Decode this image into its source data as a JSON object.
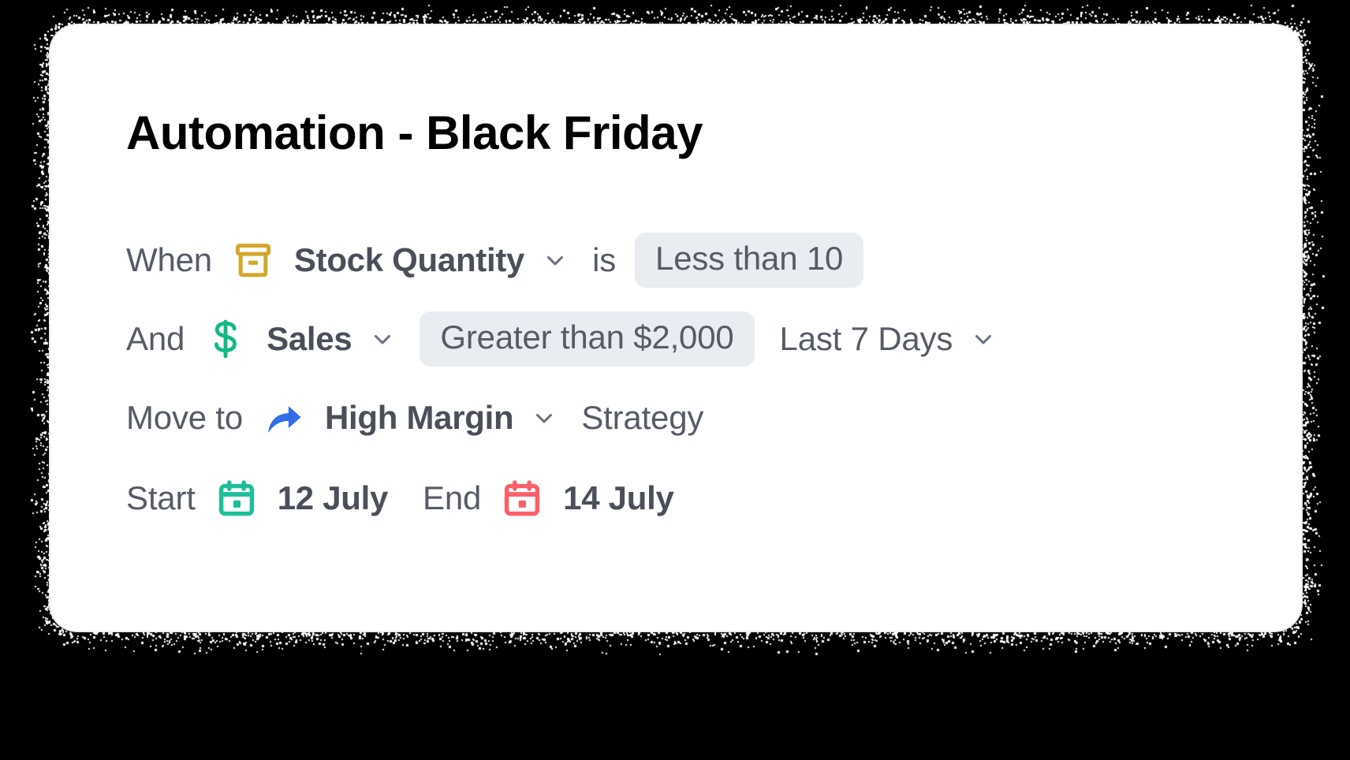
{
  "window": {
    "background_color": "#000000",
    "card_background": "#ffffff"
  },
  "card": {
    "title": "Automation - Black Friday"
  },
  "colors": {
    "text_plain": "#565b66",
    "text_bold": "#4a4f5a",
    "pill_background": "#e9ecf1",
    "stock_icon": "#d4a72c",
    "sales_icon": "#12b886",
    "move_icon": "#2f6ee6",
    "start_calendar_icon": "#1dbf9a",
    "end_calendar_icon": "#fb5f68"
  },
  "rules": [
    {
      "id": "when-stock-quantity",
      "prefix": "When",
      "icon": "inventory-box-icon",
      "field": "Stock Quantity",
      "has_field_dropdown": true,
      "operator_label": "is",
      "pill": "Less than 10",
      "suffix": null,
      "suffix_dropdown": false
    },
    {
      "id": "and-sales",
      "prefix": "And",
      "icon": "dollar-icon",
      "field": "Sales",
      "has_field_dropdown": true,
      "operator_label": null,
      "pill": "Greater than $2,000",
      "suffix": "Last 7 Days",
      "suffix_dropdown": true
    },
    {
      "id": "move-to-high-margin",
      "prefix": "Move to",
      "icon": "curved-arrow-icon",
      "field": "High Margin",
      "has_field_dropdown": true,
      "operator_label": null,
      "pill": null,
      "suffix": "Strategy",
      "suffix_dropdown": false
    }
  ],
  "schedule": {
    "start_label": "Start",
    "start_icon": "calendar-start-icon",
    "start_value": "12 July",
    "end_label": "End",
    "end_icon": "calendar-end-icon",
    "end_value": "14 July"
  }
}
